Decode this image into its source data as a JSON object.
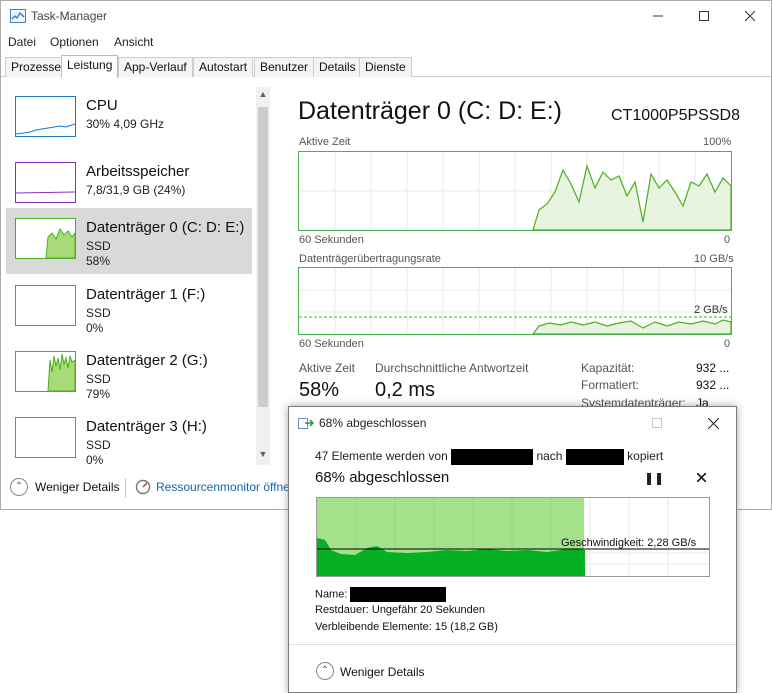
{
  "task_manager": {
    "title": "Task-Manager",
    "menu": [
      "Datei",
      "Optionen",
      "Ansicht"
    ],
    "tabs": [
      "Prozesse",
      "Leistung",
      "App-Verlauf",
      "Autostart",
      "Benutzer",
      "Details",
      "Dienste"
    ],
    "active_tab": "Leistung",
    "sidebar": [
      {
        "name": "CPU",
        "line2": "30% 4,09 GHz",
        "line3": "",
        "color": "#1a77c9"
      },
      {
        "name": "Arbeitsspeicher",
        "line2": "7,8/31,9 GB (24%)",
        "line3": "",
        "color": "#8b2fb8"
      },
      {
        "name": "Datenträger 0 (C: D: E:)",
        "line2": "SSD",
        "line3": "58%",
        "color": "#4caf1e",
        "selected": true
      },
      {
        "name": "Datenträger 1 (F:)",
        "line2": "SSD",
        "line3": "0%",
        "color": "#4caf1e"
      },
      {
        "name": "Datenträger 2 (G:)",
        "line2": "SSD",
        "line3": "79%",
        "color": "#4caf1e"
      },
      {
        "name": "Datenträger 3 (H:)",
        "line2": "SSD",
        "line3": "0%",
        "color": "#4caf1e"
      }
    ],
    "detail": {
      "title": "Datenträger 0 (C: D: E:)",
      "model": "CT1000P5PSSD8",
      "graph1": {
        "label": "Aktive Zeit",
        "max": "100%",
        "time": "60 Sekunden",
        "min": "0"
      },
      "graph2": {
        "label": "Datenträgerübertragungsrate",
        "max": "10 GB/s",
        "mark": "2 GB/s",
        "time": "60 Sekunden",
        "min": "0"
      },
      "stats": {
        "active_time_label": "Aktive Zeit",
        "active_time_value": "58%",
        "response_label": "Durchschnittliche Antwortzeit",
        "response_value": "0,2 ms",
        "capacity_label": "Kapazität:",
        "capacity_value": "932 ...",
        "formatted_label": "Formatiert:",
        "formatted_value": "932 ...",
        "system_label": "Systemdatenträger:",
        "system_value": "Ja"
      }
    },
    "fewer_details": "Weniger Details",
    "resource_monitor": "Ressourcenmonitor öffne"
  },
  "copy_dialog": {
    "title": "68% abgeschlossen",
    "copy_prefix": "47 Elemente werden von",
    "copy_mid": "nach",
    "copy_suffix": "kopiert",
    "progress_heading": "68% abgeschlossen",
    "progress": 0.68,
    "speed": "Geschwindigkeit: 2,28 GB/s",
    "name_label": "Name:",
    "remaining_label": "Restdauer:",
    "remaining_value": "Ungefähr 20 Sekunden",
    "items_label": "Verbleibende Elemente:",
    "items_value": "15 (18,2 GB)",
    "fewer_details": "Weniger Details"
  }
}
